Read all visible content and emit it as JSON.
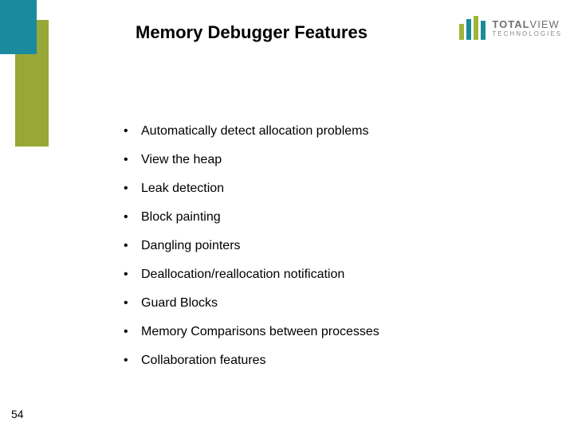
{
  "title": "Memory Debugger Features",
  "logo": {
    "line1_a": "TOTAL",
    "line1_b": "VIEW",
    "line2": "TECHNOLOGIES"
  },
  "bullets": [
    "Automatically detect allocation problems",
    "View the heap",
    "Leak detection",
    "Block painting",
    "Dangling pointers",
    "Deallocation/reallocation notification",
    "Guard Blocks",
    "Memory Comparisons between processes",
    "Collaboration features"
  ],
  "page_number": "54"
}
